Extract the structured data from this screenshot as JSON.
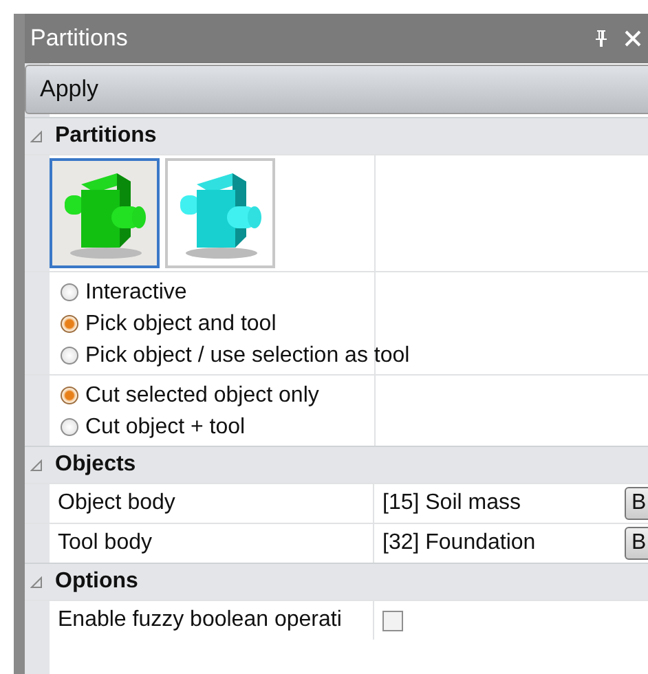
{
  "window": {
    "title": "Partitions"
  },
  "toolbar": {
    "apply": "Apply"
  },
  "partitions": {
    "title": "Partitions",
    "expanded": true,
    "modes": [
      {
        "kind": "object",
        "selected": true
      },
      {
        "kind": "tool",
        "selected": false
      }
    ],
    "pick_options": [
      {
        "label": "Interactive",
        "selected": false
      },
      {
        "label": "Pick object and tool",
        "selected": true
      },
      {
        "label": "Pick object / use selection as tool",
        "selected": false
      }
    ],
    "cut_options": [
      {
        "label": "Cut selected object only",
        "selected": true
      },
      {
        "label": "Cut object + tool",
        "selected": false
      }
    ]
  },
  "objects": {
    "title": "Objects",
    "expanded": true,
    "rows": [
      {
        "label": "Object body",
        "value": "[15] Soil mass",
        "button": "B"
      },
      {
        "label": "Tool body",
        "value": "[32] Foundation",
        "button": "B"
      }
    ]
  },
  "options": {
    "title": "Options",
    "expanded": true,
    "rows": [
      {
        "label": "Enable fuzzy boolean operati",
        "checked": false
      }
    ]
  }
}
